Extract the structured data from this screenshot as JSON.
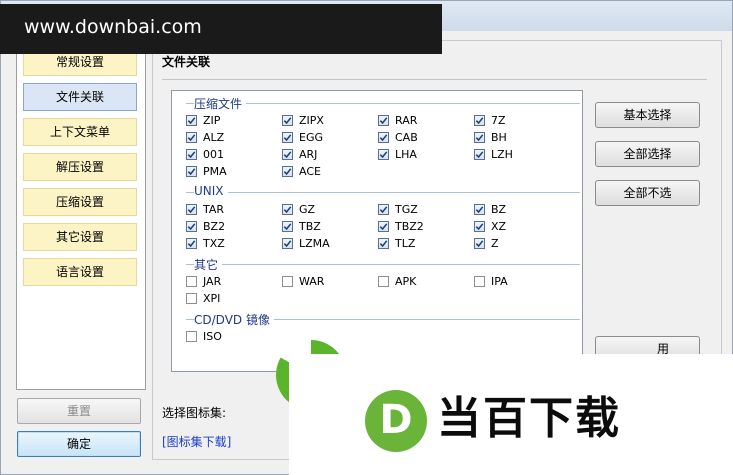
{
  "watermark": {
    "text": "www.downbai.com"
  },
  "sidebar": {
    "items": [
      {
        "label": "常规设置",
        "active": false
      },
      {
        "label": "文件关联",
        "active": true
      },
      {
        "label": "上下文菜单",
        "active": false
      },
      {
        "label": "解压设置",
        "active": false
      },
      {
        "label": "压缩设置",
        "active": false
      },
      {
        "label": "其它设置",
        "active": false
      },
      {
        "label": "语言设置",
        "active": false
      }
    ],
    "reset_label": "重置",
    "ok_label": "确定"
  },
  "main": {
    "title": "文件关联",
    "groups": [
      {
        "label": "压缩文件",
        "items": [
          {
            "label": "ZIP",
            "checked": true
          },
          {
            "label": "ZIPX",
            "checked": true
          },
          {
            "label": "RAR",
            "checked": true
          },
          {
            "label": "7Z",
            "checked": true
          },
          {
            "label": "ALZ",
            "checked": true
          },
          {
            "label": "EGG",
            "checked": true
          },
          {
            "label": "CAB",
            "checked": true
          },
          {
            "label": "BH",
            "checked": true
          },
          {
            "label": "001",
            "checked": true
          },
          {
            "label": "ARJ",
            "checked": true
          },
          {
            "label": "LHA",
            "checked": true
          },
          {
            "label": "LZH",
            "checked": true
          },
          {
            "label": "PMA",
            "checked": true
          },
          {
            "label": "ACE",
            "checked": true
          }
        ]
      },
      {
        "label": "UNIX",
        "items": [
          {
            "label": "TAR",
            "checked": true
          },
          {
            "label": "GZ",
            "checked": true
          },
          {
            "label": "TGZ",
            "checked": true
          },
          {
            "label": "BZ",
            "checked": true
          },
          {
            "label": "BZ2",
            "checked": true
          },
          {
            "label": "TBZ",
            "checked": true
          },
          {
            "label": "TBZ2",
            "checked": true
          },
          {
            "label": "XZ",
            "checked": true
          },
          {
            "label": "TXZ",
            "checked": true
          },
          {
            "label": "LZMA",
            "checked": true
          },
          {
            "label": "TLZ",
            "checked": true
          },
          {
            "label": "Z",
            "checked": true
          }
        ]
      },
      {
        "label": "其它",
        "items": [
          {
            "label": "JAR",
            "checked": false
          },
          {
            "label": "WAR",
            "checked": false
          },
          {
            "label": "APK",
            "checked": false
          },
          {
            "label": "IPA",
            "checked": false
          },
          {
            "label": "XPI",
            "checked": false
          }
        ]
      },
      {
        "label": "CD/DVD 镜像",
        "items": [
          {
            "label": "ISO",
            "checked": false
          }
        ]
      }
    ],
    "buttons": {
      "basic_select": "基本选择",
      "select_all": "全部选择",
      "select_none": "全部不选",
      "partial_fourth": "用"
    },
    "icon_set_label": "选择图标集:",
    "icon_set_link": "[图标集下载]"
  },
  "overlay_logo": {
    "mark": "D",
    "text": "当百下载"
  },
  "colors": {
    "accent": "#3c7fb1",
    "sidebar_item": "#fdf4c6",
    "sidebar_active": "#dae6f5",
    "group_label": "#1e3a8a",
    "logo_green": "#6ab43a",
    "link": "#1a3ec8"
  }
}
